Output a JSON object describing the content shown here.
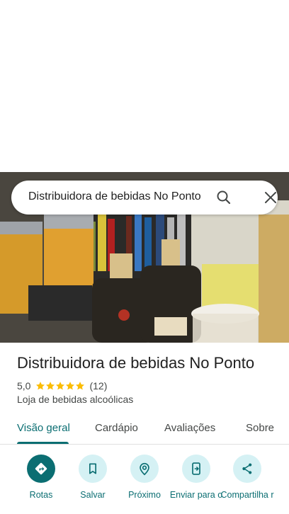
{
  "search": {
    "query": "Distribuidora de bebidas No Ponto"
  },
  "place": {
    "title": "Distribuidora de bebidas No Ponto",
    "rating": "5,0",
    "stars": 5,
    "review_count": "(12)",
    "category": "Loja de bebidas alcoólicas"
  },
  "tabs": [
    {
      "label": "Visão geral",
      "active": true
    },
    {
      "label": "Cardápio",
      "active": false
    },
    {
      "label": "Avaliações",
      "active": false
    },
    {
      "label": "Sobre",
      "active": false
    }
  ],
  "actions": [
    {
      "label": "Rotas",
      "icon": "directions-icon"
    },
    {
      "label": "Salvar",
      "icon": "bookmark-icon"
    },
    {
      "label": "Próximo",
      "icon": "nearby-icon"
    },
    {
      "label": "Enviar para o",
      "icon": "send-to-phone-icon"
    },
    {
      "label": "Compartilha r",
      "icon": "share-icon"
    }
  ],
  "colors": {
    "accent": "#0b6e72",
    "accent_light": "#d5f1f4",
    "star": "#fbbc04"
  }
}
